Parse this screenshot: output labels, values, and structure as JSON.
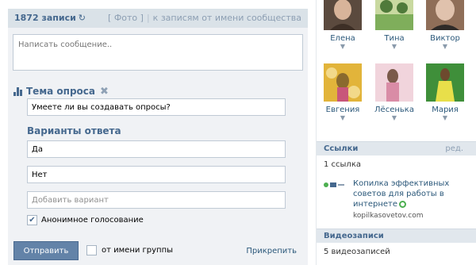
{
  "wall": {
    "count_label": "1872 записи",
    "refresh_icon": "↻",
    "photo_link": "[ Фото ]",
    "separator": "|",
    "community_link": "к записям от имени сообщества"
  },
  "composer": {
    "message_placeholder": "Написать сообщение..",
    "poll_title": "Тема опроса",
    "close_icon": "✖",
    "poll_question": "Умеете ли вы создавать опросы?",
    "answers_title": "Варианты ответа",
    "answers": [
      "Да",
      "Нет"
    ],
    "add_answer_placeholder": "Добавить вариант",
    "anonymous_label": "Анонимное голосование",
    "anonymous_checked": true,
    "send_label": "Отправить",
    "from_group_label": "от имени группы",
    "attach_label": "Прикрепить"
  },
  "friends": [
    {
      "name": "Елена",
      "arrow": "▼",
      "palette": [
        "#5b4a3e",
        "#d8b49a",
        "#3d2f26"
      ]
    },
    {
      "name": "Тина",
      "arrow": "▼",
      "palette": [
        "#7fae5b",
        "#c9d9a0",
        "#4f7a3a"
      ]
    },
    {
      "name": "Виктор",
      "arrow": "▼",
      "palette": [
        "#8f6e58",
        "#e0c2ad",
        "#2e2a28"
      ]
    },
    {
      "name": "Евгения",
      "arrow": "▼",
      "palette": [
        "#e2b43a",
        "#f2d98a",
        "#8a6a2e"
      ]
    },
    {
      "name": "Лёсенька",
      "arrow": "▼",
      "palette": [
        "#d98ca6",
        "#f1d4dc",
        "#7a5a4a"
      ]
    },
    {
      "name": "Мария",
      "arrow": "▼",
      "palette": [
        "#3f8f3a",
        "#e8df4a",
        "#6d4a2e"
      ]
    }
  ],
  "links_section": {
    "title": "Ссылки",
    "edit_label": "ред.",
    "count_label": "1 ссылка",
    "link_text": "Копилка эффективных советов для работы в интернете",
    "domain": "kopilkasovetov.com",
    "link_icon": "link-icons"
  },
  "videos_section": {
    "title": "Видеозаписи",
    "count_label": "5 видеозаписей"
  },
  "colors": {
    "accent": "#45688e",
    "header_bg": "#dae2e8",
    "panel_bg": "#f0f2f5",
    "button_bg": "#6383a8",
    "link": "#2b587a"
  }
}
